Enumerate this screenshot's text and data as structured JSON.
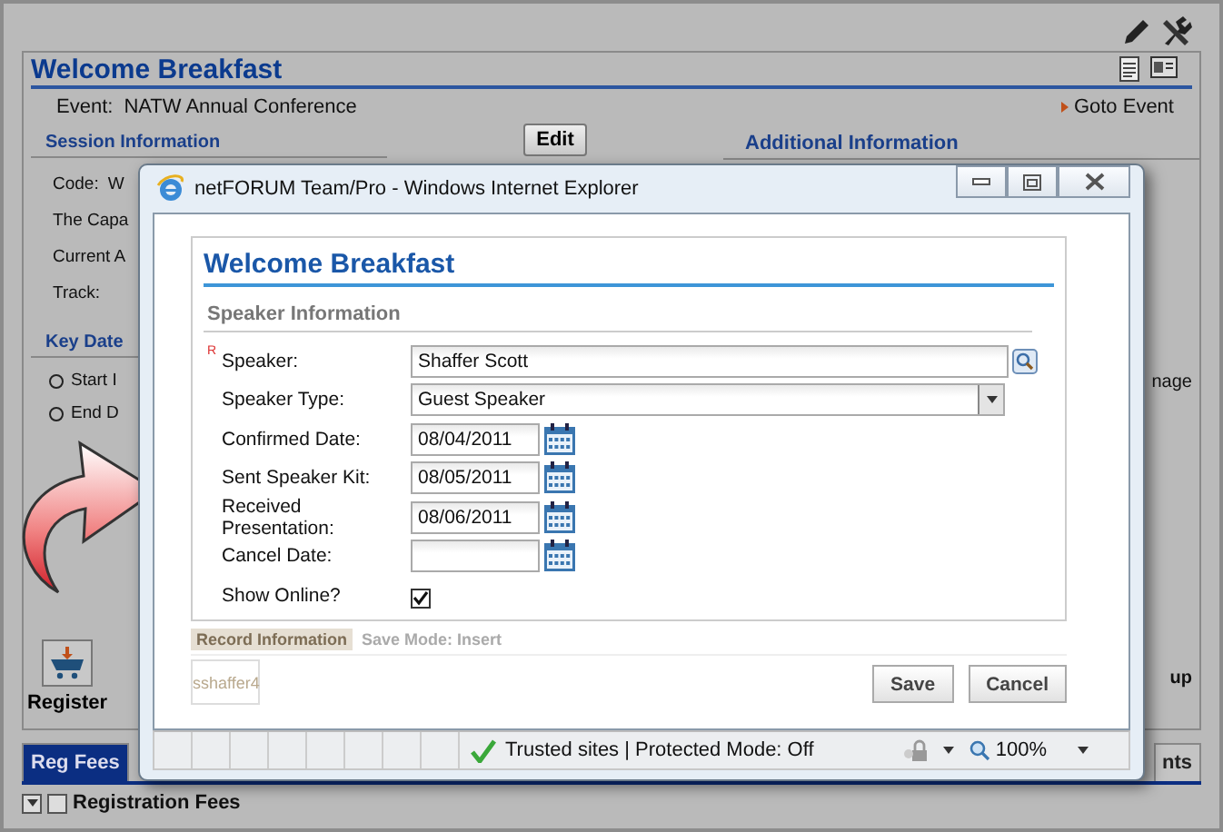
{
  "record": {
    "title": "Welcome Breakfast",
    "event_label": "Event:",
    "event_value": "NATW Annual Conference",
    "goto_link": "Goto Event",
    "edit_button": "Edit"
  },
  "session_section": {
    "title": "Session Information",
    "fields": [
      {
        "label": "Code:",
        "value": "W"
      },
      {
        "label": "The Capa"
      },
      {
        "label": "Current A"
      },
      {
        "label": "Track:"
      }
    ]
  },
  "key_dates": {
    "title": "Key Date",
    "items": [
      "Start I",
      "End D"
    ]
  },
  "additional_section": {
    "title": "Additional Information"
  },
  "right_cut_texts": [
    "nage",
    "up"
  ],
  "register_button": "Register",
  "tabs": [
    {
      "label": "Reg Fees",
      "selected": true
    },
    {
      "label": "nts",
      "selected": false
    }
  ],
  "fees_panel": {
    "title": "Registration Fees"
  },
  "popup": {
    "window_title": "netFORUM Team/Pro - Windows Internet Explorer",
    "heading": "Welcome Breakfast",
    "section": "Speaker Information",
    "fields": [
      {
        "kind": "lookup",
        "label": "Speaker:",
        "required_mark": "R",
        "value": "Shaffer Scott"
      },
      {
        "kind": "select",
        "label": "Speaker Type:",
        "value": "Guest Speaker"
      },
      {
        "kind": "date",
        "label": "Confirmed Date:",
        "value": "08/04/2011"
      },
      {
        "kind": "date",
        "label": "Sent Speaker Kit:",
        "value": "08/05/2011"
      },
      {
        "kind": "date",
        "label": "Received Presentation:",
        "value": "08/06/2011"
      },
      {
        "kind": "date",
        "label": "Cancel Date:"
      },
      {
        "kind": "checkbox",
        "label": "Show Online?",
        "checked": true
      }
    ],
    "record_info": {
      "title": "Record Information",
      "save_mode": "Save Mode: Insert",
      "user": "sshaffer4"
    },
    "buttons": [
      "Save",
      "Cancel"
    ],
    "status": {
      "security": "Trusted sites | Protected Mode: Off",
      "zoom": "100%"
    }
  }
}
